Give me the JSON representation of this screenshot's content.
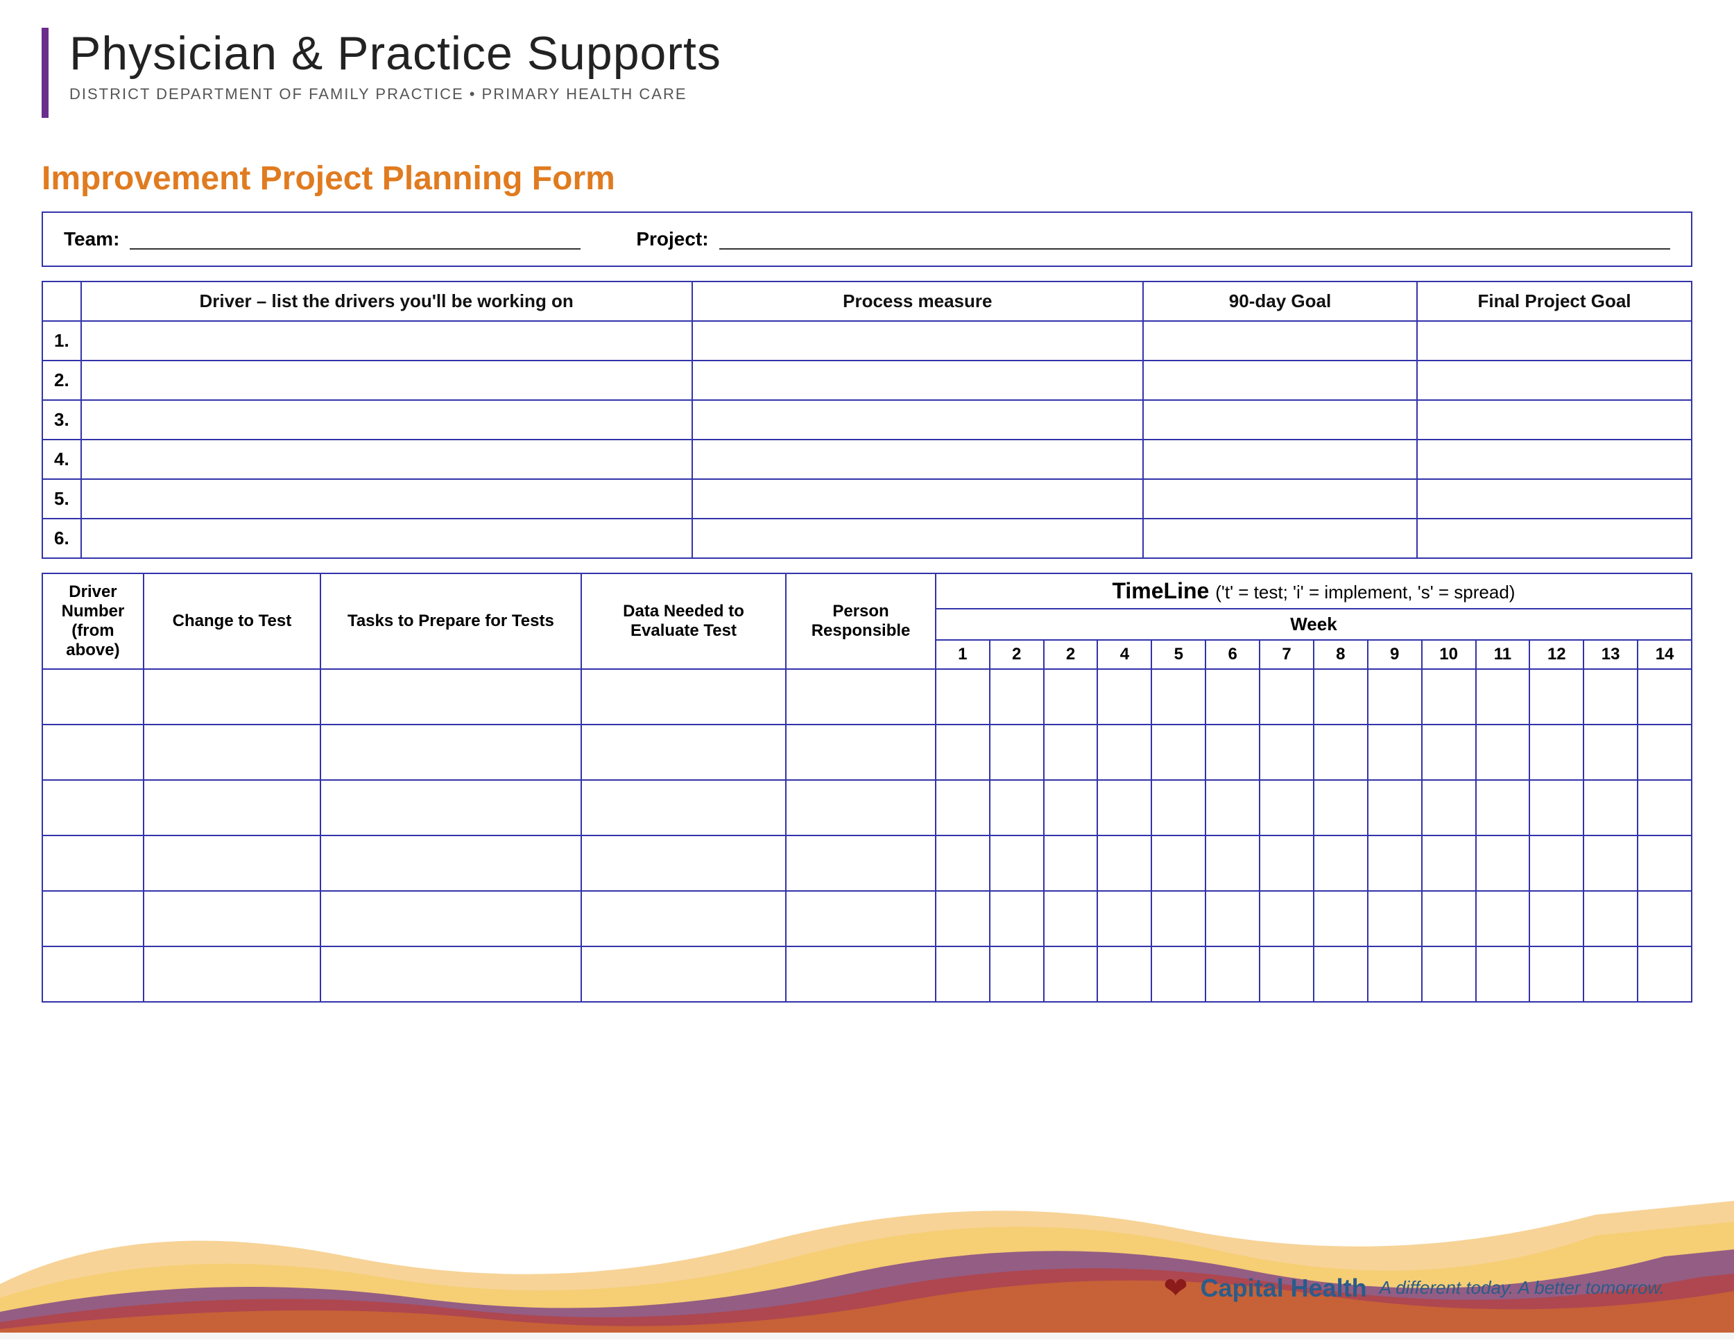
{
  "header": {
    "title": "Physician & Practice Supports",
    "subtitle": "DISTRICT DEPARTMENT OF FAMILY PRACTICE  •  PRIMARY HEALTH CARE"
  },
  "form": {
    "title": "Improvement Project Planning Form",
    "team_label": "Team:",
    "project_label": "Project:"
  },
  "driver_table": {
    "headers": {
      "driver": "Driver – list the drivers you'll be working on",
      "process": "Process measure",
      "goal90": "90-day Goal",
      "final": "Final Project Goal"
    },
    "rows": [
      {
        "num": "1."
      },
      {
        "num": "2."
      },
      {
        "num": "3."
      },
      {
        "num": "4."
      },
      {
        "num": "5."
      },
      {
        "num": "6."
      }
    ]
  },
  "timeline_table": {
    "header_label": "TimeLine",
    "header_note": "('t' = test; 'i' = implement, 's' = spread)",
    "col_headers": {
      "driver_num": "Driver Number (from above)",
      "change": "Change to Test",
      "tasks": "Tasks to Prepare for Tests",
      "data": "Data Needed to Evaluate Test",
      "person": "Person Responsible",
      "week": "Week"
    },
    "week_numbers": [
      "1",
      "2",
      "2",
      "4",
      "5",
      "6",
      "7",
      "8",
      "9",
      "10",
      "11",
      "12",
      "13",
      "14"
    ],
    "data_rows_count": 6
  },
  "footer": {
    "brand": "Capital Health",
    "tagline": "A different today. A better tomorrow."
  }
}
